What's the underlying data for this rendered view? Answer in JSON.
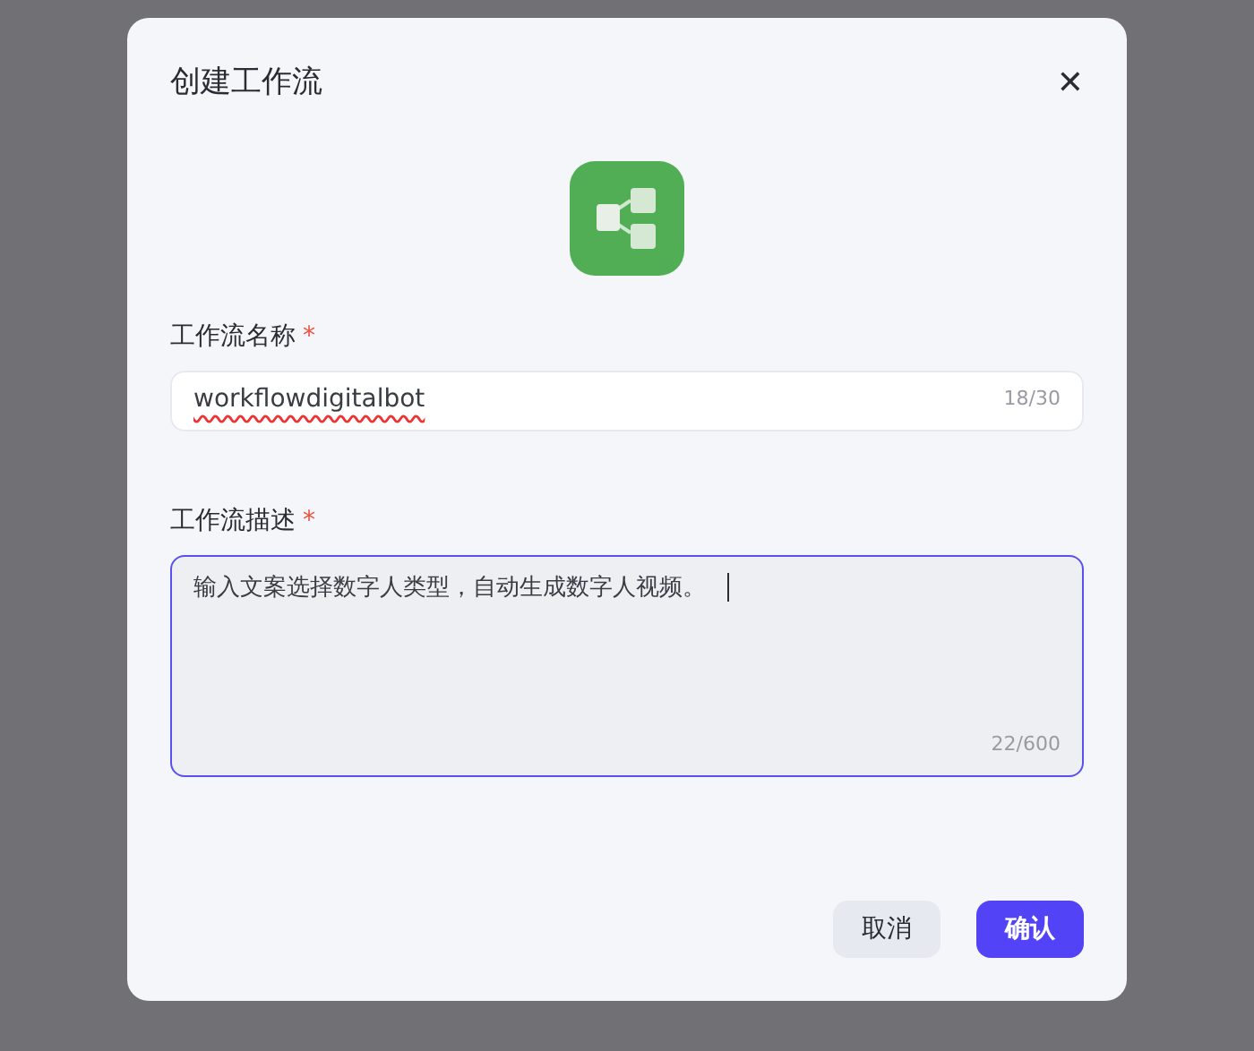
{
  "dialog": {
    "title": "创建工作流",
    "close": "✕"
  },
  "fields": [
    {
      "kind": "input",
      "label": "工作流名称",
      "required_mark": "*",
      "value": "workflowdigitalbot",
      "counter": "18/30",
      "focused": false
    },
    {
      "kind": "textarea",
      "label": "工作流描述",
      "required_mark": "*",
      "value": "输入文案选择数字人类型，自动生成数字人视频。",
      "counter": "22/600",
      "focused": true
    }
  ],
  "buttons": [
    {
      "label": "取消",
      "kind": "secondary"
    },
    {
      "label": "确认",
      "kind": "primary"
    }
  ]
}
